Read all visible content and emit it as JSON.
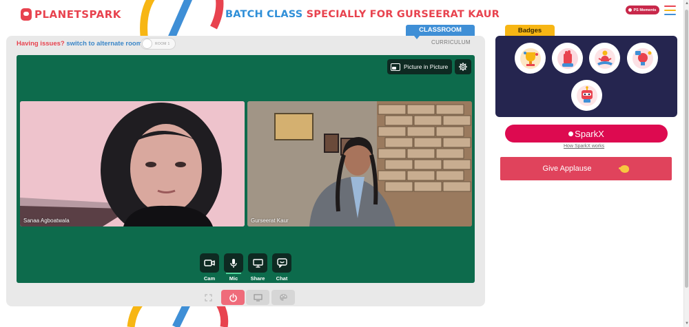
{
  "header": {
    "logo_text_1": "PLANET",
    "logo_text_2": "SPARK",
    "title_part_1": "BATCH CLASS",
    "title_part_2": "SPECIALLY FOR GURSEERAT KAUR",
    "ps_moments_label": "PS Moments"
  },
  "tabs": {
    "classroom_label": "CLASSROOM",
    "curriculum_label": "CURRICULUM"
  },
  "issues": {
    "question": "Having issues?",
    "link": "switch to alternate room",
    "room_toggle_label": "ROOM 1"
  },
  "video": {
    "pip_label": "Picture in Picture",
    "tiles": [
      {
        "name": "Sanaa Agboatwala"
      },
      {
        "name": "Gurseerat Kaur"
      }
    ]
  },
  "controls": [
    {
      "label": "Cam",
      "icon": "camera-icon"
    },
    {
      "label": "Mic",
      "icon": "mic-icon"
    },
    {
      "label": "Share",
      "icon": "screen-share-icon"
    },
    {
      "label": "Chat",
      "icon": "chat-icon"
    }
  ],
  "bottom_bar": [
    {
      "icon": "fullscreen-icon",
      "active": false
    },
    {
      "icon": "power-icon",
      "active": true
    },
    {
      "icon": "whiteboard-icon",
      "active": false
    },
    {
      "icon": "palette-icon",
      "active": false
    }
  ],
  "badges": {
    "title": "Badges",
    "items": [
      {
        "icon": "trophy-badge-icon"
      },
      {
        "icon": "hand-badge-icon"
      },
      {
        "icon": "meditation-badge-icon"
      },
      {
        "icon": "idea-badge-icon"
      },
      {
        "icon": "robot-badge-icon"
      }
    ]
  },
  "sparkx": {
    "label": "SparkX",
    "help_link": "How SparkX works"
  },
  "applause": {
    "label": "Give Applause"
  },
  "colors": {
    "brand_red": "#e8434f",
    "brand_blue": "#2f8fd8",
    "stage_green": "#0d6b4c",
    "badges_navy": "#25254f",
    "badges_tab": "#f7b614",
    "sparkx_pink": "#dd0a50",
    "applause_red": "#e0435c"
  }
}
